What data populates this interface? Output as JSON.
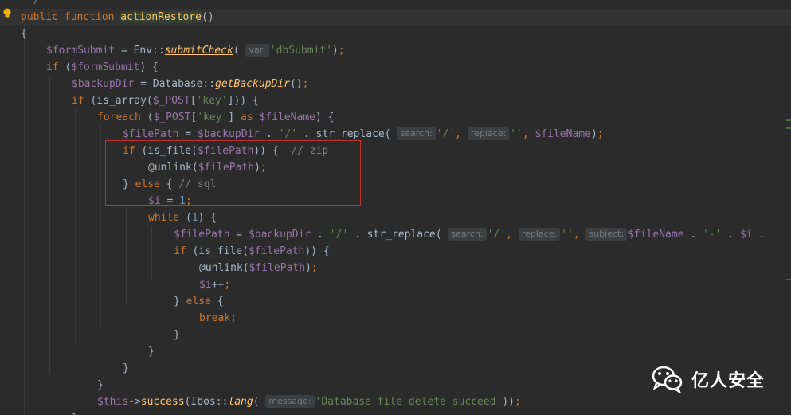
{
  "lines": [
    {
      "tokens": [
        {
          "t": "*/",
          "c": "cmt"
        }
      ]
    },
    {
      "tokens": [
        {
          "t": "public",
          "c": "kw"
        },
        {
          "t": " "
        },
        {
          "t": "function",
          "c": "kw"
        },
        {
          "t": " "
        },
        {
          "t": "actionRestore",
          "c": "fn-name-hl"
        },
        {
          "t": "()"
        }
      ]
    },
    {
      "tokens": [
        {
          "t": "{"
        }
      ]
    },
    {
      "tokens": [
        {
          "t": "$formSubmit",
          "c": "var"
        },
        {
          "t": " = Env::"
        },
        {
          "t": "submitCheck",
          "c": "fn-under"
        },
        {
          "t": "( "
        },
        {
          "t": "var:",
          "c": "hint"
        },
        {
          "t": "'dbSubmit'",
          "c": "str"
        },
        {
          "t": ")"
        },
        {
          "t": ";",
          "c": "kw"
        }
      ]
    },
    {
      "tokens": [
        {
          "t": "if",
          "c": "kw"
        },
        {
          "t": " ("
        },
        {
          "t": "$formSubmit",
          "c": "var"
        },
        {
          "t": ") {"
        }
      ]
    },
    {
      "tokens": [
        {
          "t": "$backupDir",
          "c": "var"
        },
        {
          "t": " = Database::"
        },
        {
          "t": "getBackupDir",
          "c": "fn-static"
        },
        {
          "t": "()"
        },
        {
          "t": ";",
          "c": "kw"
        }
      ]
    },
    {
      "tokens": [
        {
          "t": "if",
          "c": "kw"
        },
        {
          "t": " (is_array("
        },
        {
          "t": "$_POST",
          "c": "var"
        },
        {
          "t": "["
        },
        {
          "t": "'key'",
          "c": "str"
        },
        {
          "t": "])) {"
        }
      ]
    },
    {
      "tokens": [
        {
          "t": "foreach",
          "c": "kw"
        },
        {
          "t": " ("
        },
        {
          "t": "$_POST",
          "c": "var"
        },
        {
          "t": "["
        },
        {
          "t": "'key'",
          "c": "str"
        },
        {
          "t": "] "
        },
        {
          "t": "as",
          "c": "kw"
        },
        {
          "t": " "
        },
        {
          "t": "$fileName",
          "c": "var"
        },
        {
          "t": ") {"
        }
      ]
    },
    {
      "tokens": [
        {
          "t": "$filePath",
          "c": "var"
        },
        {
          "t": " = "
        },
        {
          "t": "$backupDir",
          "c": "var"
        },
        {
          "t": " . "
        },
        {
          "t": "'/'",
          "c": "str"
        },
        {
          "t": " . str_replace( "
        },
        {
          "t": "search:",
          "c": "hint"
        },
        {
          "t": "'/'",
          "c": "str"
        },
        {
          "t": ", ",
          "c": "kw"
        },
        {
          "t": "replace:",
          "c": "hint"
        },
        {
          "t": "''",
          "c": "str"
        },
        {
          "t": ", ",
          "c": "kw"
        },
        {
          "t": "$fileName",
          "c": "var"
        },
        {
          "t": ")"
        },
        {
          "t": ";",
          "c": "kw"
        }
      ]
    },
    {
      "tokens": [
        {
          "t": "if",
          "c": "kw"
        },
        {
          "t": " (is_file("
        },
        {
          "t": "$filePath",
          "c": "var"
        },
        {
          "t": ")) {  "
        },
        {
          "t": "// zip",
          "c": "cmt"
        }
      ]
    },
    {
      "tokens": [
        {
          "t": "@unlink("
        },
        {
          "t": "$filePath",
          "c": "var"
        },
        {
          "t": ")"
        },
        {
          "t": ";",
          "c": "kw"
        }
      ]
    },
    {
      "tokens": [
        {
          "t": "} "
        },
        {
          "t": "else",
          "c": "kw"
        },
        {
          "t": " { "
        },
        {
          "t": "// sql",
          "c": "cmt"
        }
      ]
    },
    {
      "tokens": [
        {
          "t": "$i",
          "c": "var"
        },
        {
          "t": " = "
        },
        {
          "t": "1",
          "c": "num"
        },
        {
          "t": ";",
          "c": "kw"
        }
      ]
    },
    {
      "tokens": [
        {
          "t": "while",
          "c": "kw"
        },
        {
          "t": " ("
        },
        {
          "t": "1",
          "c": "num"
        },
        {
          "t": ") {"
        }
      ]
    },
    {
      "tokens": [
        {
          "t": "$filePath",
          "c": "var"
        },
        {
          "t": " = "
        },
        {
          "t": "$backupDir",
          "c": "var"
        },
        {
          "t": " . "
        },
        {
          "t": "'/'",
          "c": "str"
        },
        {
          "t": " . str_replace( "
        },
        {
          "t": "search:",
          "c": "hint"
        },
        {
          "t": "'/'",
          "c": "str"
        },
        {
          "t": ", ",
          "c": "kw"
        },
        {
          "t": "replace:",
          "c": "hint"
        },
        {
          "t": "''",
          "c": "str"
        },
        {
          "t": ", ",
          "c": "kw"
        },
        {
          "t": "subject:",
          "c": "hint"
        },
        {
          "t": "$fileName",
          "c": "var"
        },
        {
          "t": " . "
        },
        {
          "t": "'-'",
          "c": "str"
        },
        {
          "t": " . "
        },
        {
          "t": "$i",
          "c": "var"
        },
        {
          "t": " ."
        }
      ]
    },
    {
      "tokens": [
        {
          "t": "if",
          "c": "kw"
        },
        {
          "t": " (is_file("
        },
        {
          "t": "$filePath",
          "c": "var"
        },
        {
          "t": ")) {"
        }
      ]
    },
    {
      "tokens": [
        {
          "t": "@unlink("
        },
        {
          "t": "$filePath",
          "c": "var"
        },
        {
          "t": ")"
        },
        {
          "t": ";",
          "c": "kw"
        }
      ]
    },
    {
      "tokens": [
        {
          "t": "$i",
          "c": "var"
        },
        {
          "t": "++"
        },
        {
          "t": ";",
          "c": "kw"
        }
      ]
    },
    {
      "tokens": [
        {
          "t": "} "
        },
        {
          "t": "else",
          "c": "kw"
        },
        {
          "t": " {"
        }
      ]
    },
    {
      "tokens": [
        {
          "t": "break",
          "c": "kw"
        },
        {
          "t": ";",
          "c": "kw"
        }
      ]
    },
    {
      "tokens": [
        {
          "t": "}"
        }
      ]
    },
    {
      "tokens": [
        {
          "t": "}"
        }
      ]
    },
    {
      "tokens": [
        {
          "t": "}"
        }
      ]
    },
    {
      "tokens": [
        {
          "t": "}"
        }
      ]
    },
    {
      "tokens": [
        {
          "t": "$this",
          "c": "var"
        },
        {
          "t": "->"
        },
        {
          "t": "success",
          "c": "fn-def"
        },
        {
          "t": "(Ibos::"
        },
        {
          "t": "lang",
          "c": "fn-static"
        },
        {
          "t": "( "
        },
        {
          "t": "message:",
          "c": "hint"
        },
        {
          "t": "'Database file delete succeed'",
          "c": "str"
        },
        {
          "t": "))"
        },
        {
          "t": ";",
          "c": "kw"
        }
      ]
    },
    {
      "tokens": [
        {
          "t": "}"
        }
      ]
    }
  ],
  "watermark": {
    "text": "亿人安全",
    "icon": "wechat-icon"
  },
  "icons": {
    "gutter": "lightbulb-icon"
  },
  "colors": {
    "background": "#2b2b2b",
    "keyword": "#cc7832",
    "variable": "#9876aa",
    "string": "#6a8759",
    "function": "#ffc66d",
    "highlight_box": "#c3312b"
  }
}
